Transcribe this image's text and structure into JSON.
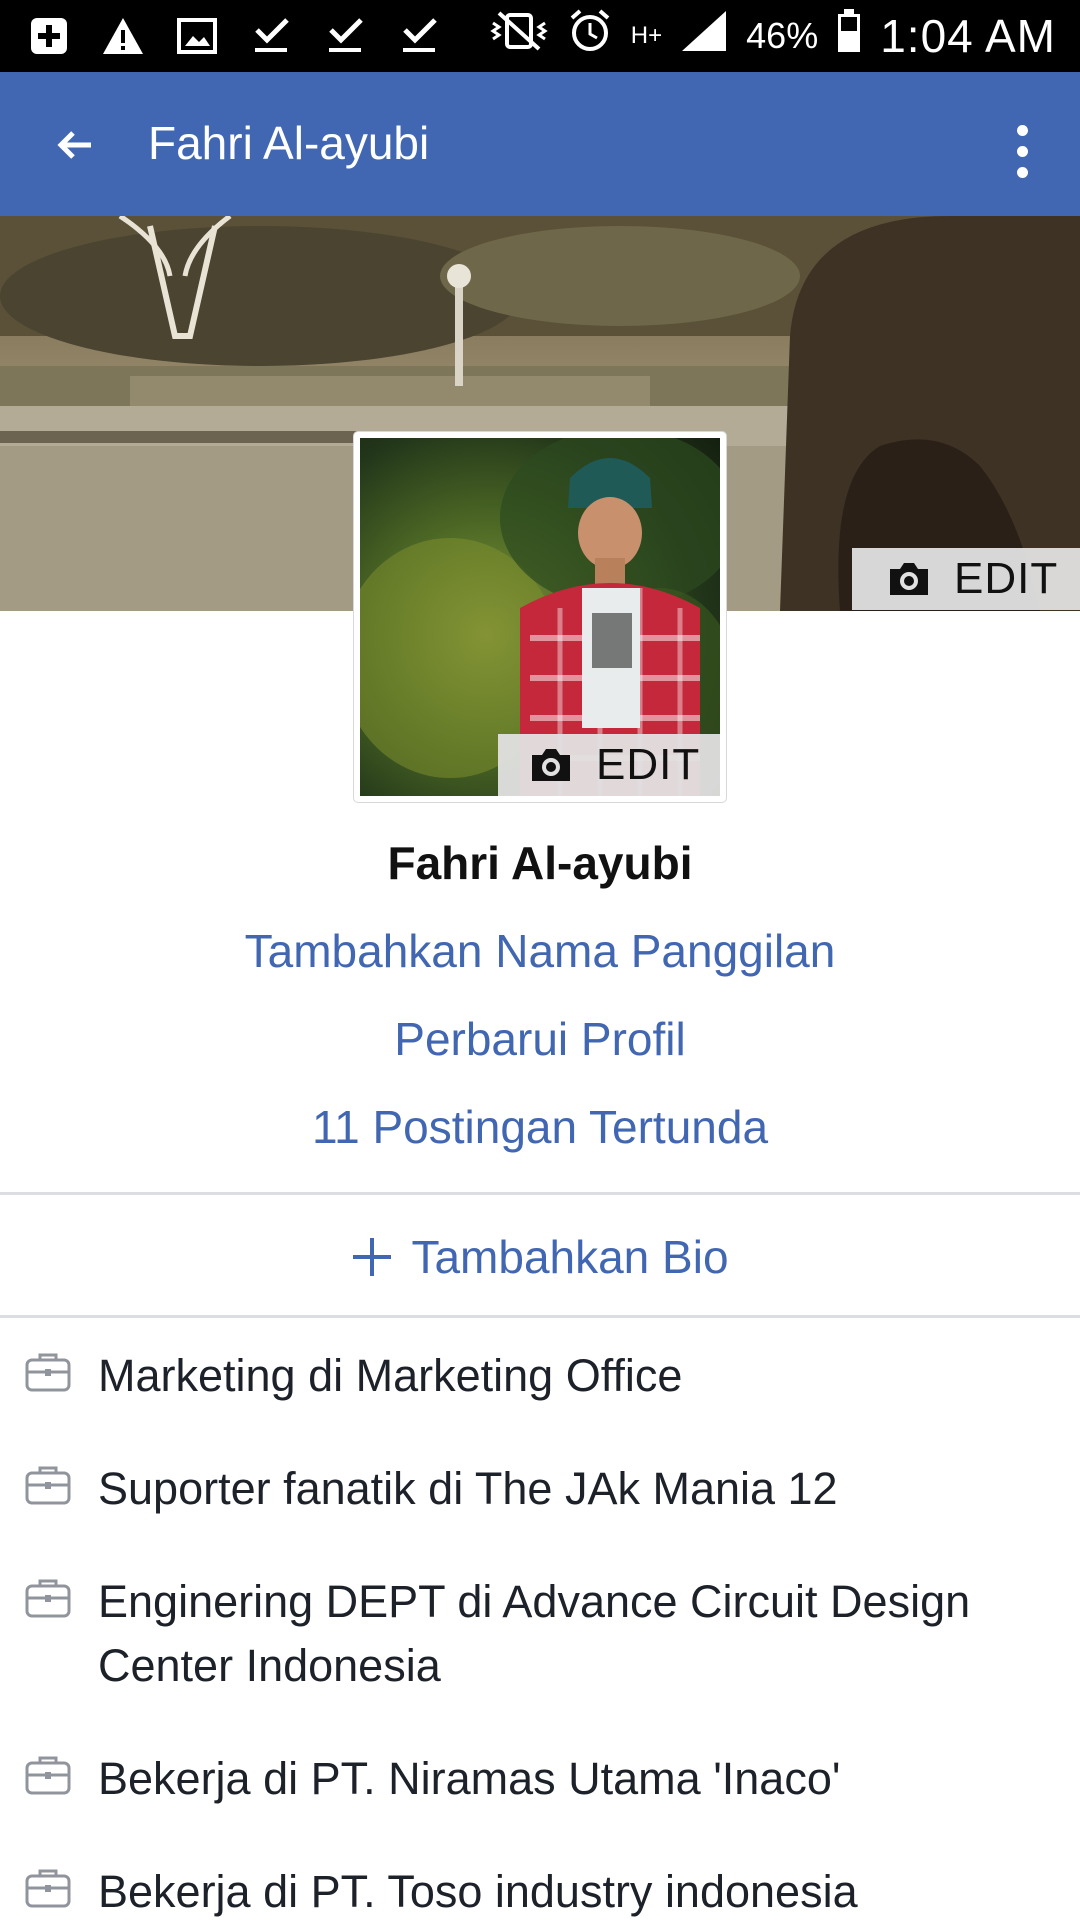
{
  "status_bar": {
    "battery": "46%",
    "time": "1:04 AM",
    "network": "H+"
  },
  "app_bar": {
    "title": "Fahri Al-ayubi"
  },
  "cover": {
    "edit_label": "EDIT"
  },
  "avatar": {
    "edit_label": "EDIT"
  },
  "profile": {
    "name": "Fahri Al-ayubi",
    "add_nickname": "Tambahkan Nama Panggilan",
    "update_profile": "Perbarui Profil",
    "pending_posts": "11 Postingan Tertunda",
    "add_bio": "Tambahkan Bio"
  },
  "work_items": [
    {
      "text": "Marketing di Marketing Office"
    },
    {
      "text": "Suporter fanatik di The JAk Mania 12"
    },
    {
      "text": "Enginering DEPT di Advance Circuit Design Center Indonesia"
    },
    {
      "text": "Bekerja di PT. Niramas Utama 'Inaco'"
    },
    {
      "text": "Bekerja di PT. Toso industry indonesia"
    }
  ],
  "colors": {
    "brand": "#4267b2",
    "link": "#4267b2",
    "status_bar": "#000000"
  }
}
